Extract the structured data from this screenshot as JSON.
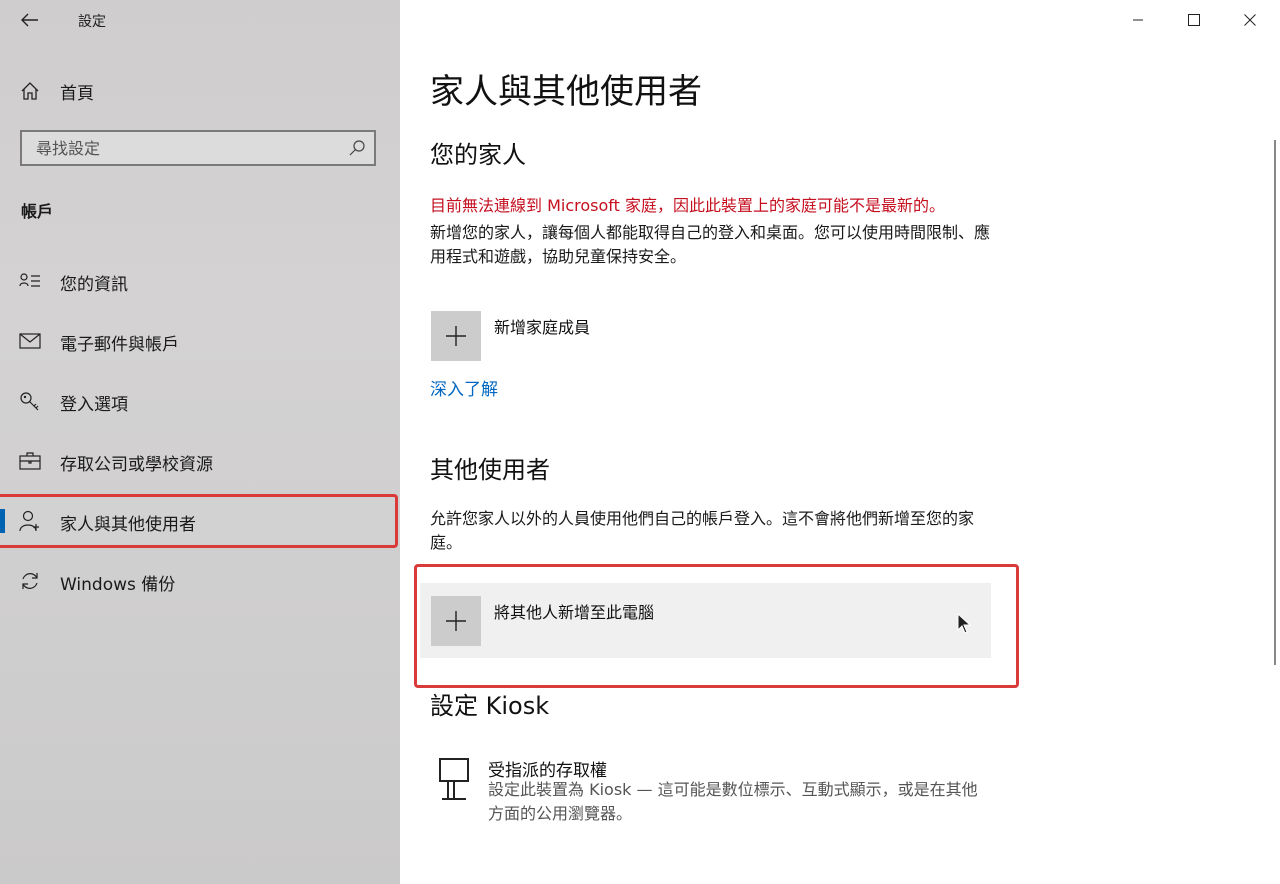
{
  "window": {
    "app_title": "設定",
    "controls": [
      "minimize",
      "maximize",
      "close"
    ]
  },
  "sidebar": {
    "home_label": "首頁",
    "search_placeholder": "尋找設定",
    "section_header": "帳戶",
    "items": [
      {
        "label": "您的資訊",
        "icon": "person-list-icon",
        "selected": false
      },
      {
        "label": "電子郵件與帳戶",
        "icon": "mail-icon",
        "selected": false
      },
      {
        "label": "登入選項",
        "icon": "key-icon",
        "selected": false
      },
      {
        "label": "存取公司或學校資源",
        "icon": "briefcase-icon",
        "selected": false
      },
      {
        "label": "家人與其他使用者",
        "icon": "person-icon",
        "selected": true
      },
      {
        "label": "Windows 備份",
        "icon": "sync-icon",
        "selected": false
      }
    ]
  },
  "main": {
    "page_title": "家人與其他使用者",
    "family": {
      "heading": "您的家人",
      "error": "目前無法連線到 Microsoft 家庭，因此此裝置上的家庭可能不是最新的。",
      "description": "新增您的家人，讓每個人都能取得自己的登入和桌面。您可以使用時間限制、應用程式和遊戲，協助兒童保持安全。",
      "add_label": "新增家庭成員",
      "learn_more": "深入了解"
    },
    "other_users": {
      "heading": "其他使用者",
      "description": "允許您家人以外的人員使用他們自己的帳戶登入。這不會將他們新增至您的家庭。",
      "add_label": "將其他人新增至此電腦"
    },
    "kiosk": {
      "heading": "設定 Kiosk",
      "title": "受指派的存取權",
      "description": "設定此裝置為 Kiosk — 這可能是數位標示、互動式顯示，或是在其他方面的公用瀏覽器。"
    }
  },
  "colors": {
    "accent": "#0067c0",
    "error": "#c50f1f",
    "highlight_box": "#d93a3a",
    "selection_bar": "#0063b1"
  }
}
